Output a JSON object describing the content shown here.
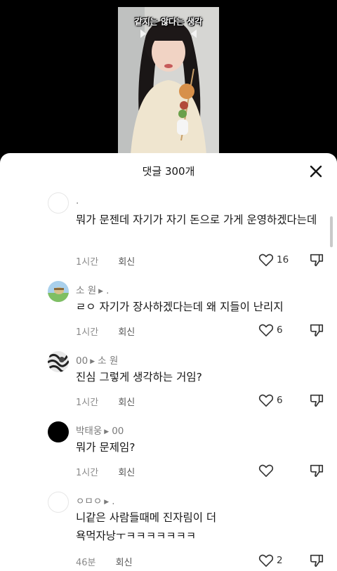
{
  "video": {
    "caption": "같지는 않다는 생각"
  },
  "sheet": {
    "title": "댓글 300개",
    "close_icon": "close-icon"
  },
  "comments": [
    {
      "username": ".",
      "reply_to": "",
      "text": "뭐가 문젠데 자기가 자기 돈으로 가게 운영하겠다는데",
      "time": "1시간",
      "reply_label": "회신",
      "likes": "16",
      "avatar": "blank"
    },
    {
      "username": "소 원",
      "reply_to": ".",
      "text": "ㄹㅇ 자기가 장사하겠다는데 왜 지들이 난리지",
      "time": "1시간",
      "reply_label": "회신",
      "likes": "6",
      "avatar": "landscape"
    },
    {
      "username": "00",
      "reply_to": "소 원",
      "text": "진심 그렇게 생각하는 거임?",
      "time": "1시간",
      "reply_label": "회신",
      "likes": "6",
      "avatar": "pattern"
    },
    {
      "username": "박태웅",
      "reply_to": "00",
      "text": "뭐가 문제임?",
      "time": "1시간",
      "reply_label": "회신",
      "likes": "",
      "avatar": "black"
    },
    {
      "username": "ㅇㅁㅇ",
      "reply_to": ".",
      "text": "니같은 사람들때메 진자림이 더 욕먹자낭ㅜㅋㅋㅋㅋㅋㅋㅋ",
      "time": "46분",
      "reply_label": "회신",
      "likes": "2",
      "avatar": "blank"
    }
  ],
  "colors": {
    "sheet_bg": "#ffffff",
    "text": "#161616",
    "muted": "#8a8a8a"
  }
}
